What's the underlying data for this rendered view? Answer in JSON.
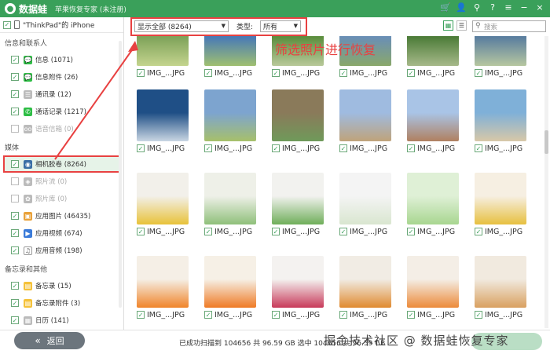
{
  "app": {
    "name": "数据蛙",
    "subtitle": "苹果恢复专家 (未注册)"
  },
  "titlebar_icons": [
    "cart-icon",
    "user-icon",
    "key-icon",
    "help-icon",
    "menu-icon",
    "minimize-icon",
    "close-icon"
  ],
  "titlebar_glyphs": [
    "🛒",
    "👤",
    "⚲",
    "?",
    "≡",
    "−",
    "×"
  ],
  "device": {
    "name": "\"ThinkPad\"的 iPhone"
  },
  "sidebar": {
    "section1": "信息和联系人",
    "items1": [
      {
        "label": "信息 (1071)",
        "icon": "message-icon",
        "checked": true,
        "disabled": false
      },
      {
        "label": "信息附件 (26)",
        "icon": "attachment-icon",
        "checked": true,
        "disabled": false
      },
      {
        "label": "通讯录 (12)",
        "icon": "contacts-icon",
        "checked": true,
        "disabled": false
      },
      {
        "label": "通话记录 (1217)",
        "icon": "phone-icon",
        "checked": true,
        "disabled": false
      },
      {
        "label": "语音信箱 (0)",
        "icon": "voicemail-icon",
        "checked": false,
        "disabled": true
      }
    ],
    "section2": "媒体",
    "items2": [
      {
        "label": "相机胶卷 (8264)",
        "icon": "camera-icon",
        "checked": true,
        "disabled": false,
        "selected": true
      },
      {
        "label": "照片流 (0)",
        "icon": "photostream-icon",
        "checked": false,
        "disabled": true
      },
      {
        "label": "照片库 (0)",
        "icon": "photolibrary-icon",
        "checked": false,
        "disabled": true
      },
      {
        "label": "应用图片 (46435)",
        "icon": "app-photos-icon",
        "checked": true,
        "disabled": false
      },
      {
        "label": "应用视频 (674)",
        "icon": "app-video-icon",
        "checked": true,
        "disabled": false
      },
      {
        "label": "应用音频 (198)",
        "icon": "music-icon",
        "checked": true,
        "disabled": false
      }
    ],
    "section3": "备忘录和其他",
    "items3": [
      {
        "label": "备忘录 (15)",
        "icon": "notes-icon",
        "checked": true,
        "disabled": false
      },
      {
        "label": "备忘录附件 (3)",
        "icon": "notes-attachment-icon",
        "checked": true,
        "disabled": false
      },
      {
        "label": "日历 (141)",
        "icon": "calendar-icon",
        "checked": true,
        "disabled": false
      }
    ]
  },
  "toolbar": {
    "show_filter": "显示全部 (8264)",
    "type_label": "类型:",
    "type_value": "所有",
    "search_placeholder": "搜索"
  },
  "annotation": "筛选照片进行恢复",
  "photos": {
    "caption": "IMG_...JPG",
    "rows": [
      [
        {
          "c1": "#7fa35a",
          "c2": "#c4d48e"
        },
        {
          "c1": "#4a7bb5",
          "c2": "#a0c070"
        },
        {
          "c1": "#5d8f3f",
          "c2": "#b9c99a"
        },
        {
          "c1": "#6a8fb5",
          "c2": "#8aa86a"
        },
        {
          "c1": "#4e7d3a",
          "c2": "#a7b98a"
        },
        {
          "c1": "#5b7f9f",
          "c2": "#b7c7a0"
        }
      ],
      [
        {
          "c1": "#1f4f86",
          "c2": "#c9d6e3"
        },
        {
          "c1": "#7da4cf",
          "c2": "#a7c06a"
        },
        {
          "c1": "#8a7a5a",
          "c2": "#6f9a5a"
        },
        {
          "c1": "#9fbbe0",
          "c2": "#bfa37a"
        },
        {
          "c1": "#a9c4e6",
          "c2": "#b08060"
        },
        {
          "c1": "#7fb0d8",
          "c2": "#d8c8a8"
        }
      ],
      [
        {
          "c1": "#f2f0ea",
          "c2": "#e8c23a"
        },
        {
          "c1": "#eef0e8",
          "c2": "#8fc07a"
        },
        {
          "c1": "#f2f2ef",
          "c2": "#6fae5a"
        },
        {
          "c1": "#f4f4f4",
          "c2": "#d9e6d0"
        },
        {
          "c1": "#dff0d6",
          "c2": "#a8d690"
        },
        {
          "c1": "#f6efe2",
          "c2": "#e7c040"
        }
      ],
      [
        {
          "c1": "#f5efe6",
          "c2": "#f0842a"
        },
        {
          "c1": "#f6f0e6",
          "c2": "#ef7a25"
        },
        {
          "c1": "#f4f2f0",
          "c2": "#c83a5a"
        },
        {
          "c1": "#f1ece4",
          "c2": "#e08a30"
        },
        {
          "c1": "#f4eee6",
          "c2": "#ec8a3a"
        },
        {
          "c1": "#f1eadf",
          "c2": "#d9a060"
        }
      ]
    ]
  },
  "status": "已成功扫描到 104656 共 96.59 GB  选中 104656 共 96.59 GB",
  "back_button": "返回",
  "watermark": "掘金技术社区 @ 数据蛙恢复专家"
}
